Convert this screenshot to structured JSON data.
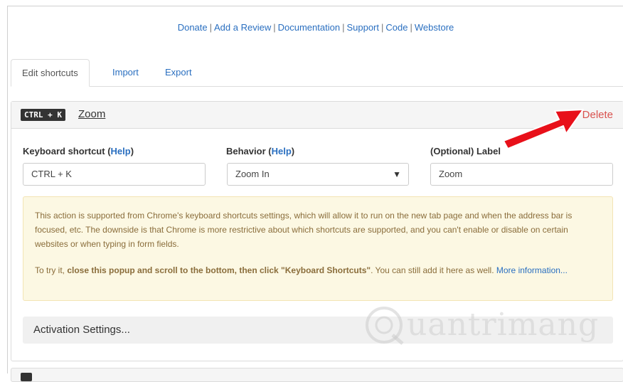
{
  "links": [
    "Donate",
    "Add a Review",
    "Documentation",
    "Support",
    "Code",
    "Webstore"
  ],
  "link_separator": "|",
  "tabs": [
    "Edit shortcuts",
    "Import",
    "Export"
  ],
  "shortcut": {
    "key_combo": "CTRL + K",
    "label": "Zoom",
    "delete_label": "Delete",
    "fields": {
      "keyboard_label": "Keyboard shortcut",
      "behavior_label": "Behavior",
      "optional_label": "(Optional) Label",
      "help_text": "Help",
      "keyboard_value": "CTRL + K",
      "behavior_value": "Zoom In",
      "label_value": "Zoom"
    },
    "notice": {
      "paragraph1": "This action is supported from Chrome's keyboard shortcuts settings, which will allow it to run on the new tab page and when the address bar is focused, etc. The downside is that Chrome is more restrictive about which shortcuts are supported, and you can't enable or disable on certain websites or when typing in form fields.",
      "p2_prefix": "To try it, ",
      "p2_bold": "close this popup and scroll to the bottom, then click \"Keyboard Shortcuts\"",
      "p2_suffix": ". You can still add it here as well. ",
      "p2_link": "More information..."
    },
    "activation_label": "Activation Settings..."
  },
  "watermark": "uantrimang",
  "colors": {
    "link": "#2a6fc0",
    "delete": "#d9534f",
    "arrow": "#e8101a",
    "notice_bg": "#fcf8e3"
  },
  "icons": {
    "select_caret": "▼",
    "arrow": "red-arrow-pointing-to-delete"
  }
}
